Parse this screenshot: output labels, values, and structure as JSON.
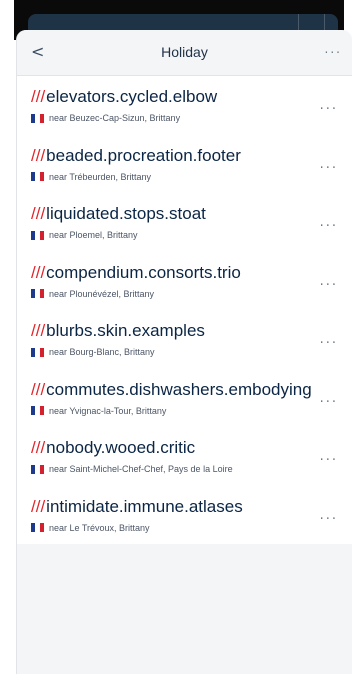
{
  "header": {
    "back_label": "<",
    "title": "Holiday",
    "more_label": "..."
  },
  "flag_colors": [
    "#1d3a8c",
    "#ffffff",
    "#d3212d"
  ],
  "accent_color": "#e0262b",
  "items": [
    {
      "prefix": "///",
      "words": "elevators.cycled.elbow",
      "near": "near Beuzec-Cap-Sizun, Brittany",
      "menu": "..."
    },
    {
      "prefix": "///",
      "words": "beaded.procreation.footer",
      "near": "near Trébeurden, Brittany",
      "menu": "..."
    },
    {
      "prefix": "///",
      "words": "liquidated.stops.stoat",
      "near": "near Ploemel, Brittany",
      "menu": "..."
    },
    {
      "prefix": "///",
      "words": "compendium.consorts.trio",
      "near": "near Plounévézel, Brittany",
      "menu": "..."
    },
    {
      "prefix": "///",
      "words": "blurbs.skin.examples",
      "near": "near Bourg-Blanc, Brittany",
      "menu": "..."
    },
    {
      "prefix": "///",
      "words": "commutes.dishwashers.embodying",
      "near": "near Yvignac-la-Tour, Brittany",
      "menu": "..."
    },
    {
      "prefix": "///",
      "words": "nobody.wooed.critic",
      "near": "near Saint-Michel-Chef-Chef, Pays de la Loire",
      "menu": "..."
    },
    {
      "prefix": "///",
      "words": "intimidate.immune.atlases",
      "near": "near Le Trévoux, Brittany",
      "menu": "..."
    }
  ]
}
